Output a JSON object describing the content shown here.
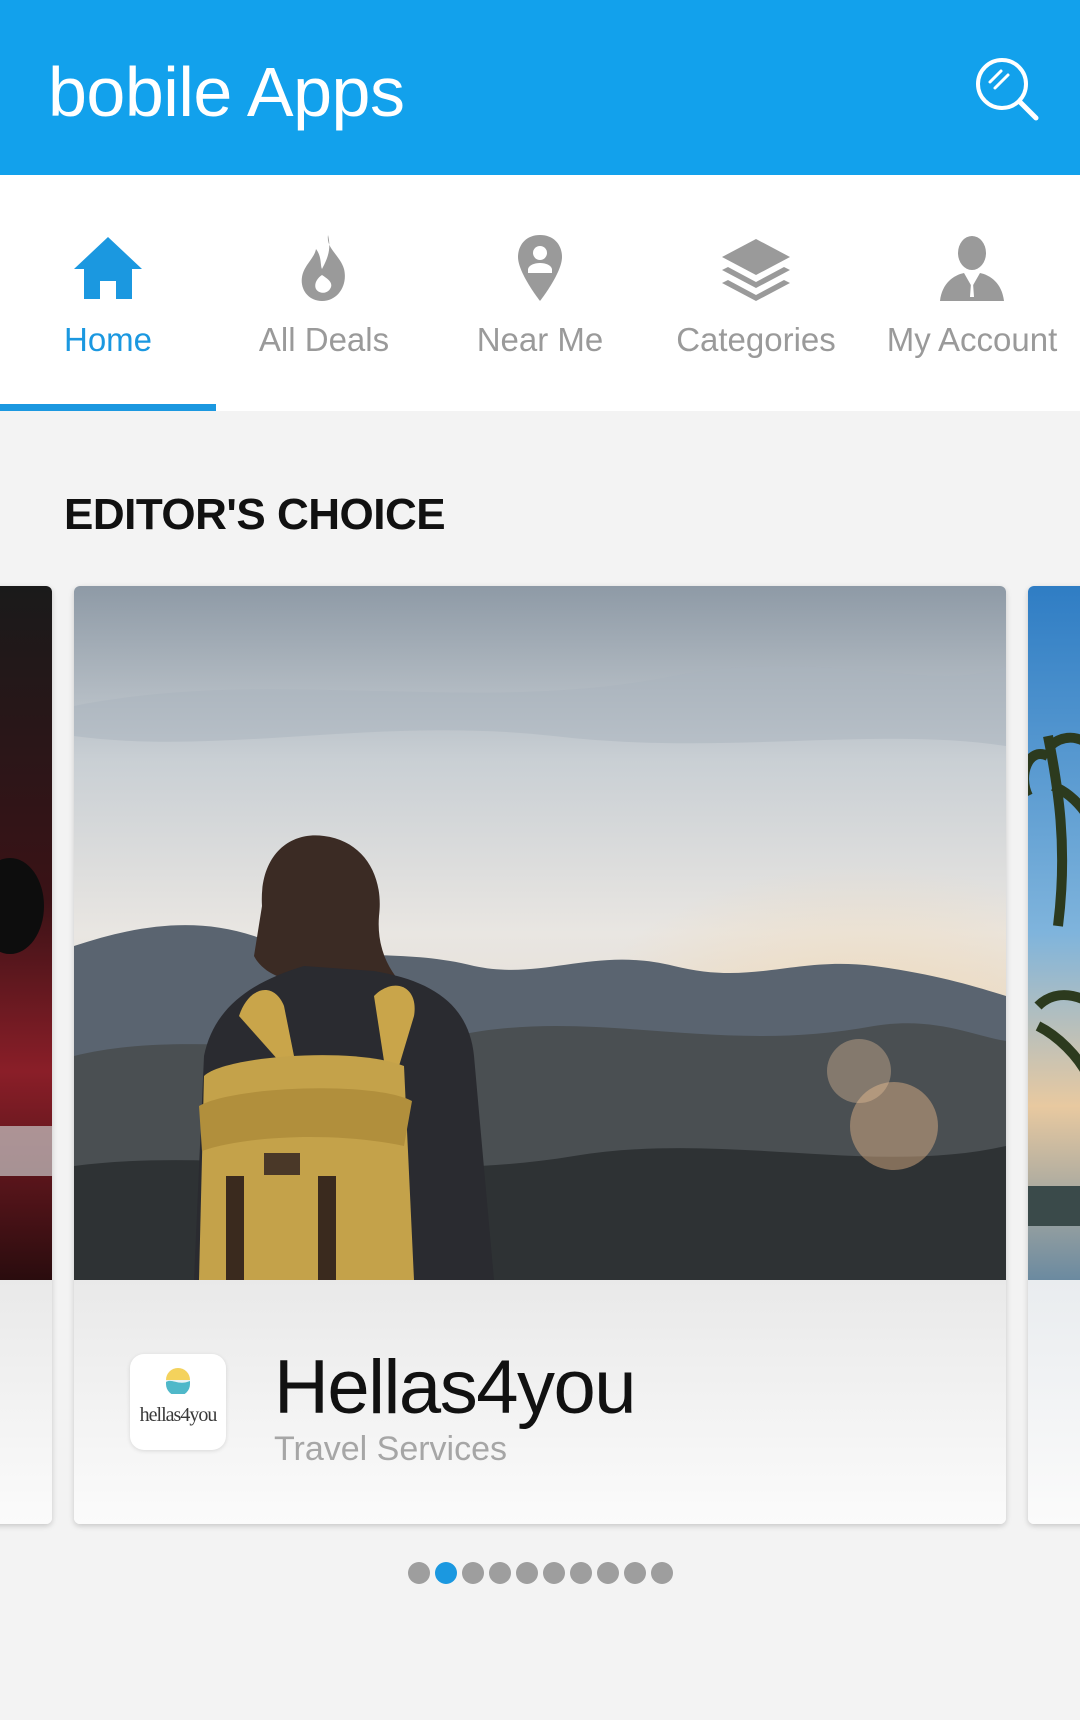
{
  "header": {
    "title": "bobile Apps",
    "background_color": "#12a1ec",
    "search_icon": "search-icon"
  },
  "tabs": [
    {
      "label": "Home",
      "icon": "home-icon",
      "active": true
    },
    {
      "label": "All Deals",
      "icon": "flame-icon",
      "active": false
    },
    {
      "label": "Near Me",
      "icon": "location-pin-icon",
      "active": false
    },
    {
      "label": "Categories",
      "icon": "layers-icon",
      "active": false
    },
    {
      "label": "My Account",
      "icon": "user-icon",
      "active": false
    }
  ],
  "colors": {
    "accent": "#1b98e0",
    "inactive": "#9a9a9a"
  },
  "section": {
    "title": "EDITOR'S CHOICE"
  },
  "featured": {
    "title": "Hellas4you",
    "subtitle": "Travel Services",
    "logo_text": "hellas4you"
  },
  "pagination": {
    "total": 10,
    "current": 2
  }
}
